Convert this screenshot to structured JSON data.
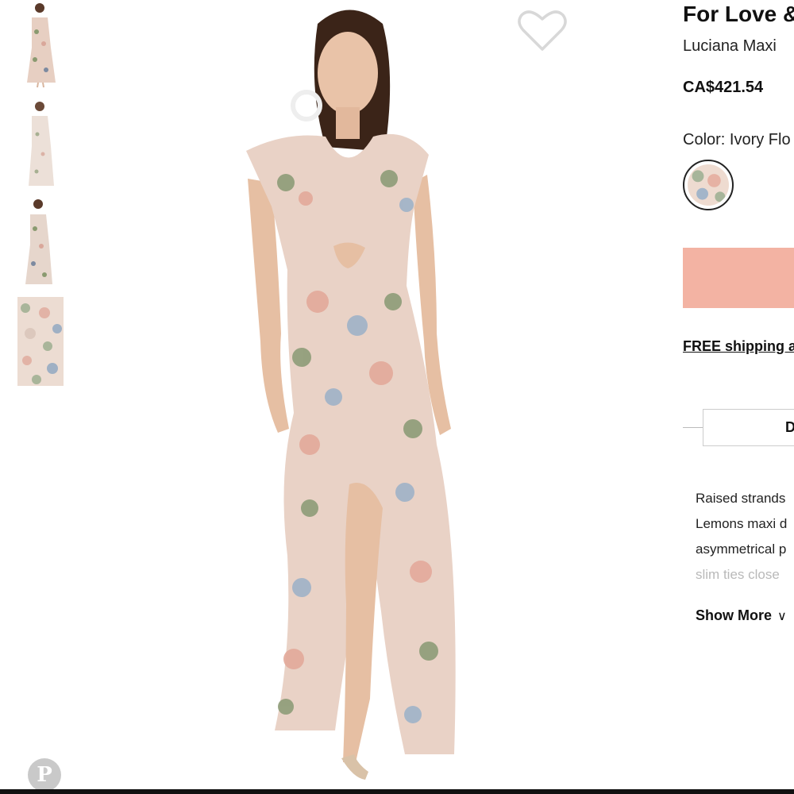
{
  "product": {
    "brand": "For Love &",
    "name": "Luciana Maxi",
    "price": "CA$421.54",
    "color_label": "Color: Ivory Flo"
  },
  "shipping_link": "FREE shipping a",
  "tab_label": "D",
  "description": {
    "lines": [
      "Raised strands",
      "Lemons maxi d",
      "asymmetrical p",
      "slim ties close"
    ]
  },
  "show_more": "Show More",
  "pinterest": "P",
  "colors": {
    "add_button": "#f3b3a3",
    "dress_base": "#e9d2c6"
  },
  "icons": {
    "wishlist": "heart-outline-icon",
    "pinterest": "pinterest-icon",
    "show_more": "chevron-down-icon"
  }
}
